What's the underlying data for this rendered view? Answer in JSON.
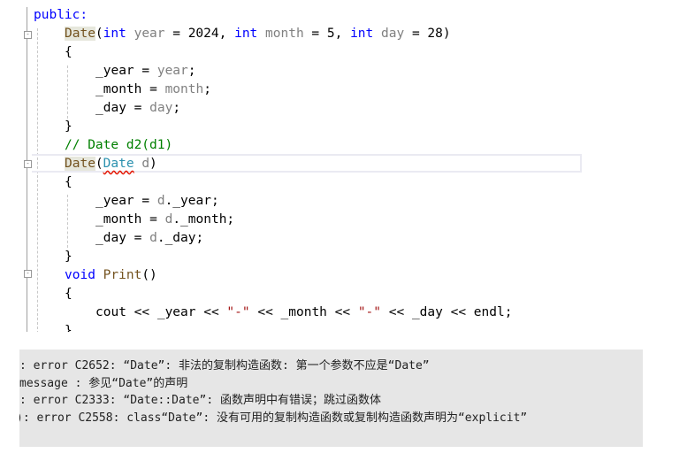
{
  "editor": {
    "lines": [
      {
        "indent": 0,
        "tokens": [
          {
            "t": "public:",
            "c": "kw"
          }
        ]
      },
      {
        "indent": 1,
        "tokens": [
          {
            "t": "Date",
            "c": "fn"
          },
          {
            "t": "(",
            "c": ""
          },
          {
            "t": "int",
            "c": "kw"
          },
          {
            "t": " ",
            "c": ""
          },
          {
            "t": "year",
            "c": "param"
          },
          {
            "t": " = 2024, ",
            "c": ""
          },
          {
            "t": "int",
            "c": "kw"
          },
          {
            "t": " ",
            "c": ""
          },
          {
            "t": "month",
            "c": "param"
          },
          {
            "t": " = 5, ",
            "c": ""
          },
          {
            "t": "int",
            "c": "kw"
          },
          {
            "t": " ",
            "c": ""
          },
          {
            "t": "day",
            "c": "param"
          },
          {
            "t": " = 28)",
            "c": ""
          }
        ]
      },
      {
        "indent": 1,
        "tokens": [
          {
            "t": "{",
            "c": ""
          }
        ]
      },
      {
        "indent": 2,
        "tokens": [
          {
            "t": "_year = ",
            "c": ""
          },
          {
            "t": "year",
            "c": "param"
          },
          {
            "t": ";",
            "c": ""
          }
        ]
      },
      {
        "indent": 2,
        "tokens": [
          {
            "t": "_month = ",
            "c": ""
          },
          {
            "t": "month",
            "c": "param"
          },
          {
            "t": ";",
            "c": ""
          }
        ]
      },
      {
        "indent": 2,
        "tokens": [
          {
            "t": "_day = ",
            "c": ""
          },
          {
            "t": "day",
            "c": "param"
          },
          {
            "t": ";",
            "c": ""
          }
        ]
      },
      {
        "indent": 1,
        "tokens": [
          {
            "t": "}",
            "c": ""
          }
        ]
      },
      {
        "indent": 1,
        "tokens": [
          {
            "t": "// Date d2(d1)",
            "c": "cm"
          }
        ]
      },
      {
        "indent": 1,
        "tokens": [
          {
            "t": "Date",
            "c": "fn"
          },
          {
            "t": "(",
            "c": ""
          },
          {
            "t": "Date",
            "c": "ty squig"
          },
          {
            "t": " ",
            "c": ""
          },
          {
            "t": "d",
            "c": "param"
          },
          {
            "t": ")",
            "c": ""
          }
        ]
      },
      {
        "indent": 1,
        "tokens": [
          {
            "t": "{",
            "c": ""
          }
        ]
      },
      {
        "indent": 2,
        "tokens": [
          {
            "t": "_year = ",
            "c": ""
          },
          {
            "t": "d",
            "c": "param"
          },
          {
            "t": "._year;",
            "c": ""
          }
        ]
      },
      {
        "indent": 2,
        "tokens": [
          {
            "t": "_month = ",
            "c": ""
          },
          {
            "t": "d",
            "c": "param"
          },
          {
            "t": "._month;",
            "c": ""
          }
        ]
      },
      {
        "indent": 2,
        "tokens": [
          {
            "t": "_day = ",
            "c": ""
          },
          {
            "t": "d",
            "c": "param"
          },
          {
            "t": "._day;",
            "c": ""
          }
        ]
      },
      {
        "indent": 1,
        "tokens": [
          {
            "t": "}",
            "c": ""
          }
        ]
      },
      {
        "indent": 1,
        "tokens": [
          {
            "t": "void",
            "c": "kw"
          },
          {
            "t": " ",
            "c": ""
          },
          {
            "t": "Print",
            "c": "fnp"
          },
          {
            "t": "()",
            "c": ""
          }
        ]
      },
      {
        "indent": 1,
        "tokens": [
          {
            "t": "{",
            "c": ""
          }
        ]
      },
      {
        "indent": 2,
        "tokens": [
          {
            "t": "cout << _year << ",
            "c": ""
          },
          {
            "t": "\"-\"",
            "c": "str"
          },
          {
            "t": " << _month << ",
            "c": ""
          },
          {
            "t": "\"-\"",
            "c": "str"
          },
          {
            "t": " << _day << endl;",
            "c": ""
          }
        ]
      },
      {
        "indent": 1,
        "tokens": [
          {
            "t": "}",
            "c": ""
          }
        ]
      }
    ]
  },
  "output": {
    "lines": [
      ": error C2652: “Date”: 非法的复制构造函数: 第一个参数不应是“Date”",
      "message : 参见“Date”的声明",
      ": error C2333: “Date::Date”: 函数声明中有错误；跳过函数体",
      "): error C2558: class“Date”: 没有可用的复制构造函数或复制构造函数声明为“explicit”"
    ]
  },
  "colors": {
    "keyword": "#0000ff",
    "parameter": "#808080",
    "comment": "#008000",
    "type": "#2b91af",
    "string": "#a31515",
    "error_squiggle": "#e51400",
    "output_bg": "#e6e6e6"
  }
}
